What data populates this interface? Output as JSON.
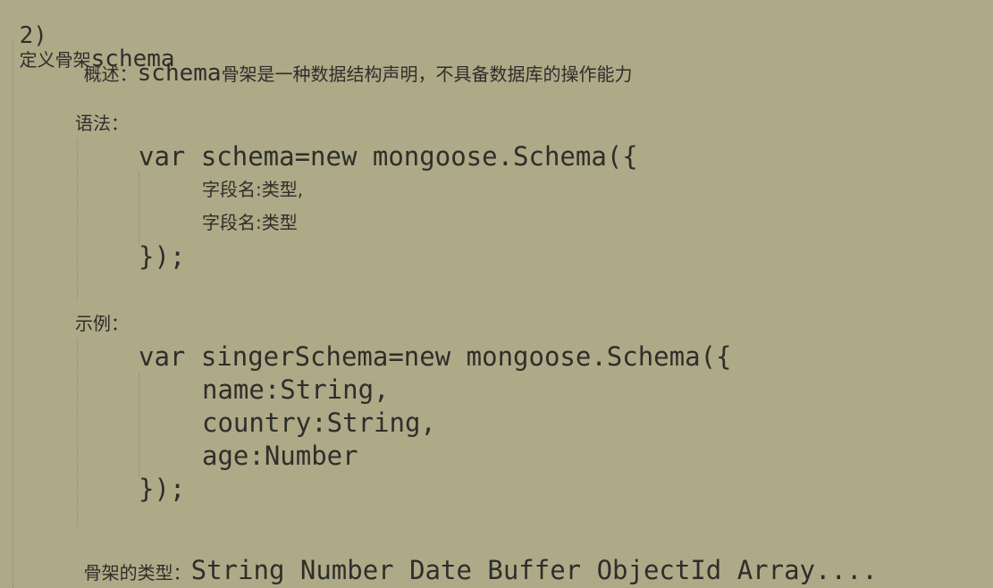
{
  "heading": {
    "num": "2)",
    "title": "定义骨架",
    "title_code": "schema"
  },
  "overview": {
    "label": "概述：",
    "code": "schema",
    "text": "骨架是一种数据结构声明，不具备数据库的操作能力"
  },
  "syntax": {
    "label": "语法：",
    "lines": [
      "var schema=new mongoose.Schema({",
      "字段名:类型,",
      "字段名:类型",
      "});"
    ]
  },
  "example": {
    "label": "示例：",
    "lines": [
      "var singerSchema=new mongoose.Schema({",
      "name:String,",
      "country:String,",
      "age:Number",
      "});"
    ]
  },
  "types": {
    "label": "骨架的类型：",
    "values": "String Number Date Buffer ObjectId Array...."
  }
}
